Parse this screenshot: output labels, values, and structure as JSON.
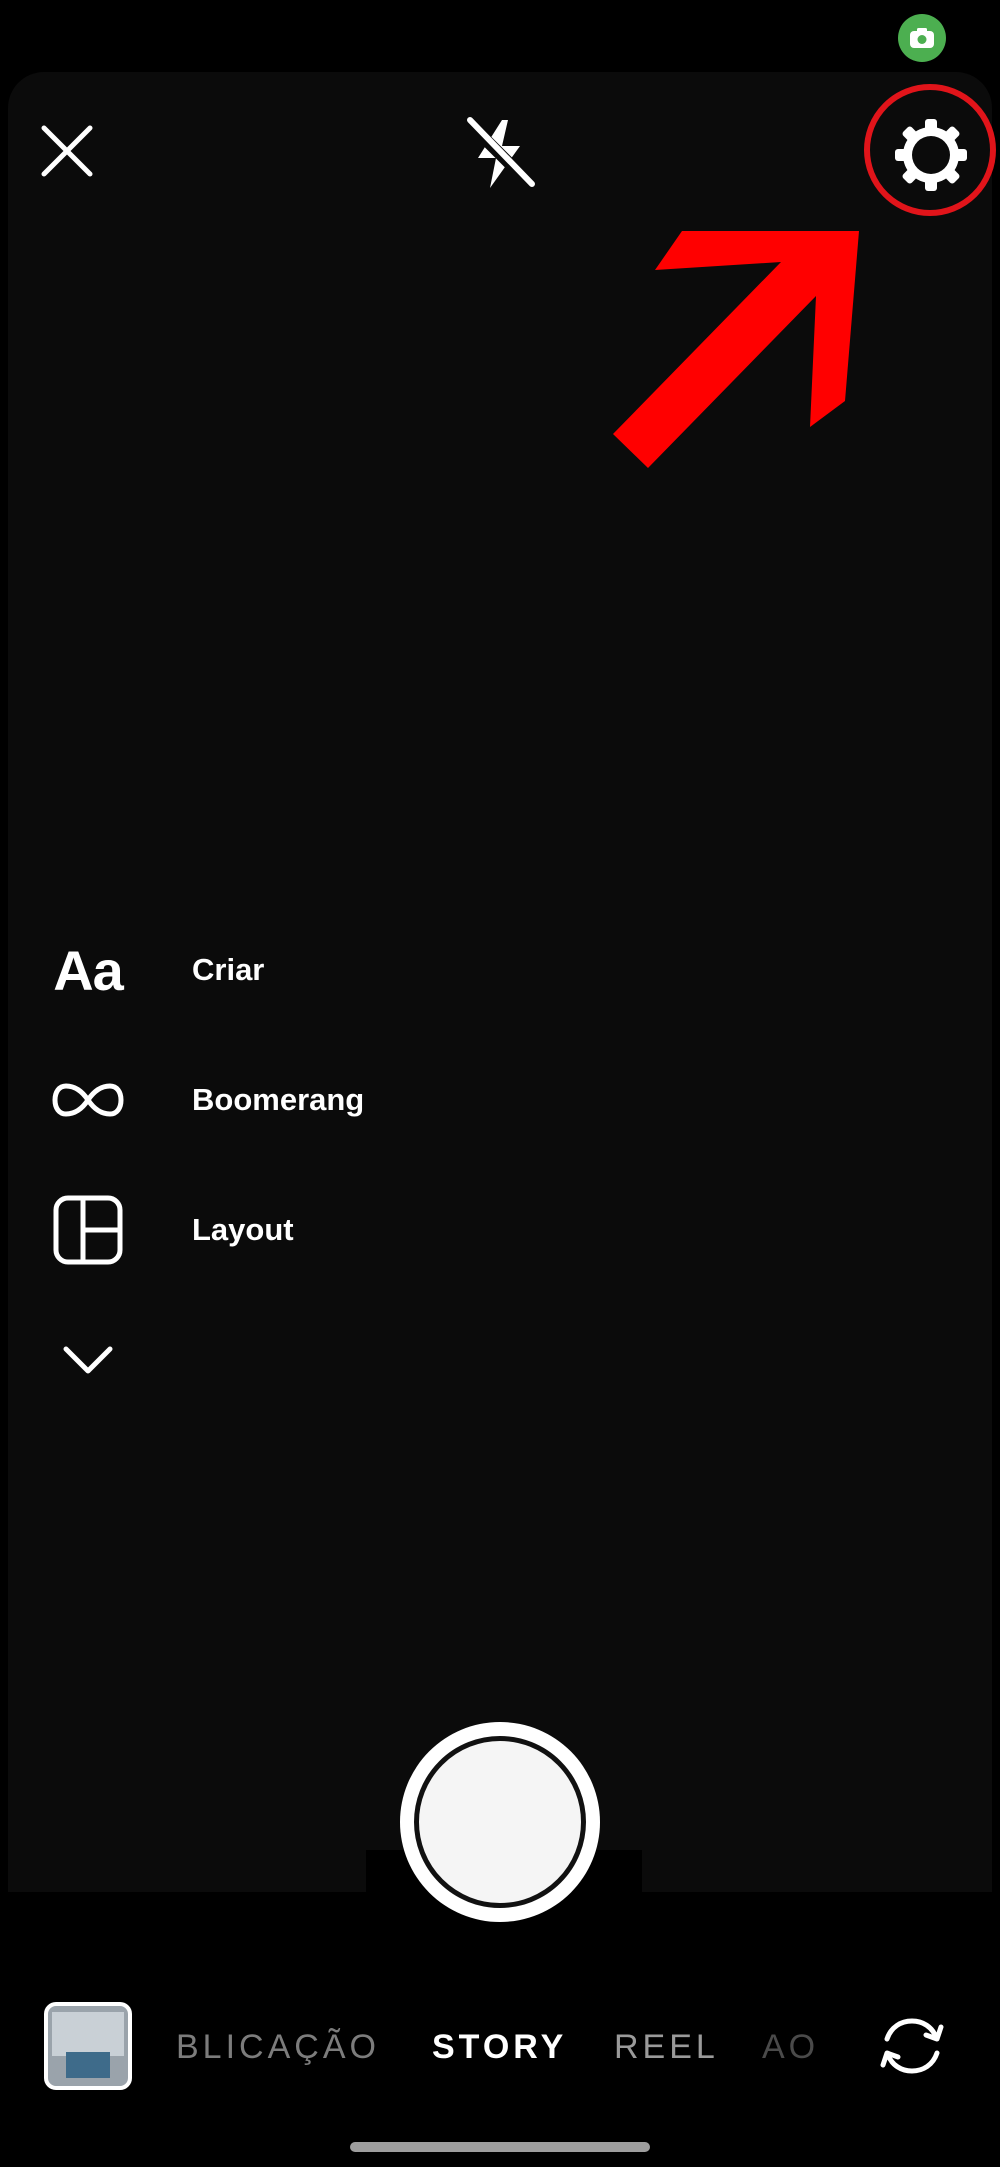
{
  "status_bar": {
    "app_icon": "camera-icon"
  },
  "top_bar": {
    "close_icon": "close-icon",
    "flash_icon": "flash-off-icon",
    "settings_icon": "gear-icon"
  },
  "annotation": {
    "color": "#e1141a"
  },
  "tools": [
    {
      "icon": "text-aa-icon",
      "glyph": "Aa",
      "label": "Criar"
    },
    {
      "icon": "infinity-icon",
      "label": "Boomerang"
    },
    {
      "icon": "layout-grid-icon",
      "label": "Layout"
    },
    {
      "icon": "chevron-down-icon",
      "label": ""
    }
  ],
  "modes": {
    "items": [
      "BLICAÇÃO",
      "STORY",
      "REEL",
      "AO"
    ],
    "selected": "STORY"
  },
  "colors": {
    "background": "#000000",
    "status_cam": "#4caf50",
    "accent_annotation": "#e1141a"
  }
}
